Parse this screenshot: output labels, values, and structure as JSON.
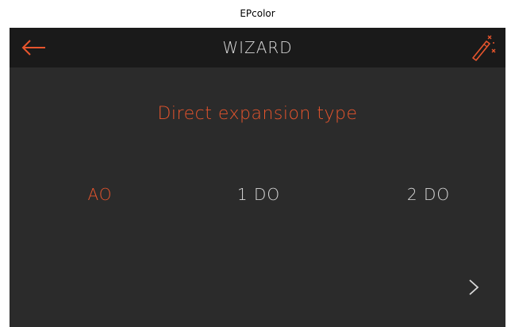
{
  "app_label": "EPcolor",
  "header": {
    "title": "WIZARD",
    "back_icon": "arrow-left-icon",
    "wand_icon": "magic-wand-icon"
  },
  "question": "Direct expansion type",
  "options": [
    {
      "label": "AO",
      "selected": true
    },
    {
      "label": "1 DO",
      "selected": false
    },
    {
      "label": "2 DO",
      "selected": false
    }
  ],
  "next_icon": "chevron-right-icon",
  "colors": {
    "accent": "#e8552d",
    "header_bg": "#1a1a1a",
    "content_bg": "#2b2b2b",
    "text_light": "#d9d9d9"
  }
}
